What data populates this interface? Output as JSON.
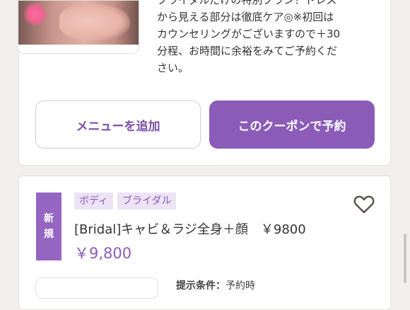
{
  "coupon_1": {
    "description": "ブライダルだけの特別プラン！ドレス\nから見える部分は徹底ケア◎※初回は\nカウンセリングがございますので＋30\n分程、お時間に余裕をみてご予約くだ\nさい。",
    "add_menu_label": "メニューを追加",
    "reserve_label": "このクーポンで予約"
  },
  "coupon_2": {
    "badge_line1": "新",
    "badge_line2": "規",
    "tags": [
      "ボディ",
      "ブライダル"
    ],
    "title": "[Bridal]キャビ＆ラジ全身＋顔　￥9800",
    "price": "￥9,800",
    "condition_label": "提示条件：",
    "condition_value": "予約時"
  },
  "colors": {
    "accent": "#8a5cb8",
    "badge": "#9565c2",
    "tag_bg": "#ece3f4",
    "page_bg": "#f1f0ee"
  },
  "icons": {
    "favorite": "heart-outline-icon"
  }
}
